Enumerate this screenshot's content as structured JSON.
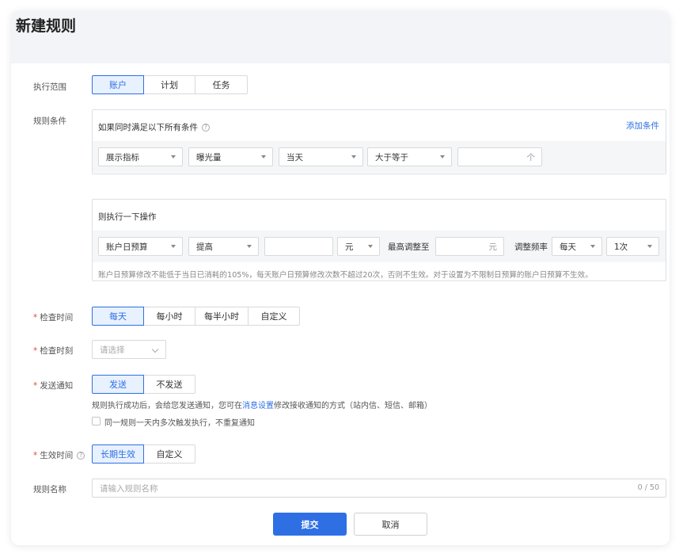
{
  "page": {
    "title": "新建规则"
  },
  "scope": {
    "label": "执行范围",
    "options": [
      "账户",
      "计划",
      "任务"
    ],
    "selected": "账户"
  },
  "condition": {
    "label": "规则条件",
    "heading": "如果同时满足以下所有条件",
    "help_icon": "question-circle-icon",
    "add_link": "添加条件",
    "metric_type": "展示指标",
    "metric": "曝光量",
    "period": "当天",
    "operator": "大于等于",
    "value": "",
    "unit": "个"
  },
  "action": {
    "heading": "则执行一下操作",
    "target": "账户日预算",
    "direction": "提高",
    "amount": "",
    "unit_select": "元",
    "max_label": "最高调整至",
    "max_value": "",
    "max_unit": "元",
    "freq_label": "调整频率",
    "freq_period": "每天",
    "freq_times": "1次",
    "note": "账户日预算修改不能低于当日已消耗的105%，每天账户日预算修改次数不超过20次，否则不生效。对于设置为不限制日预算的账户日预算不生效。"
  },
  "check_time": {
    "required": "*",
    "label": "检查时间",
    "options": [
      "每天",
      "每小时",
      "每半小时",
      "自定义"
    ],
    "selected": "每天"
  },
  "check_moment": {
    "required": "*",
    "label": "检查时刻",
    "placeholder": "请选择"
  },
  "notify": {
    "required": "*",
    "label": "发送通知",
    "options": [
      "发送",
      "不发送"
    ],
    "selected": "发送",
    "desc_prefix": "规则执行成功后，会给您发送通知，您可在",
    "desc_link": "消息设置",
    "desc_suffix": "修改接收通知的方式（站内信、短信、邮箱）",
    "dedupe_label": "同一规则一天内多次触发执行，不重复通知"
  },
  "effective": {
    "required": "*",
    "label": "生效时间",
    "help_icon": "question-circle-icon",
    "options": [
      "长期生效",
      "自定义"
    ],
    "selected": "长期生效"
  },
  "rule_name": {
    "label": "规则名称",
    "placeholder": "请输入规则名称",
    "counter": "0 / 50"
  },
  "footer": {
    "submit": "提交",
    "cancel": "取消"
  },
  "colors": {
    "primary": "#2f6fe4",
    "required": "#e5483c"
  }
}
